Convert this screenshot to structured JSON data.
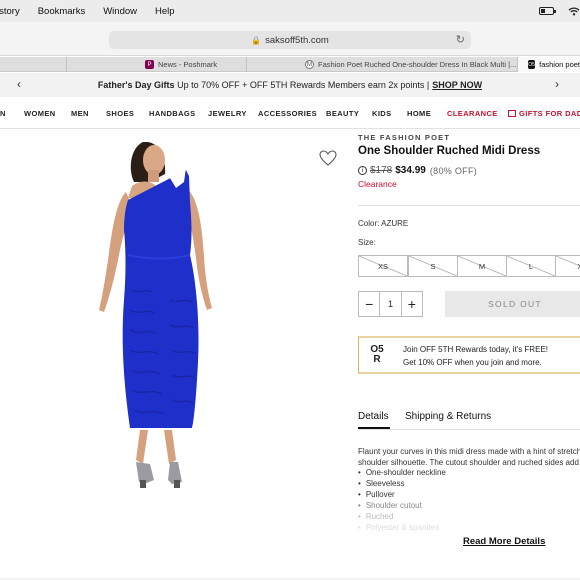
{
  "menubar": {
    "items": [
      "istory",
      "Bookmarks",
      "Window",
      "Help"
    ]
  },
  "browser": {
    "url": "saksoff5th.com",
    "tabs": [
      {
        "title": "News - Poshmark",
        "favicon": "P"
      },
      {
        "title": "Fashion Poet Ruched One-shoulder Dress In Black Multi |...",
        "favicon": "M"
      },
      {
        "title": "fashion poet",
        "favicon": "O5"
      }
    ]
  },
  "promo": {
    "bold": "Father's Day Gifts",
    "text": "Up to 70% OFF + OFF 5TH Rewards Members earn 2x points |",
    "link": "SHOP NOW"
  },
  "nav": {
    "items": [
      "N",
      "WOMEN",
      "MEN",
      "SHOES",
      "HANDBAGS",
      "JEWELRY",
      "ACCESSORIES",
      "BEAUTY",
      "KIDS",
      "HOME",
      "CLEARANCE",
      "GIFTS FOR DAD"
    ]
  },
  "product": {
    "brand": "THE FASHION POET",
    "title": "One Shoulder Ruched Midi Dress",
    "price_was": "$178",
    "price_now": "$34.99",
    "discount": "(80% OFF)",
    "tag": "Clearance",
    "color_label": "Color: AZURE",
    "size_label": "Size:",
    "sizes": [
      "XS",
      "S",
      "M",
      "L",
      "X"
    ],
    "qty": "1",
    "sold_out": "SOLD OUT",
    "dress_color": "#1f2fc9"
  },
  "rewards": {
    "logo_top": "O5",
    "logo_bottom": "R",
    "line1": "Join OFF 5TH Rewards today, it's FREE!",
    "line2": "Get 10% OFF when you join and more."
  },
  "details": {
    "tab1": "Details",
    "tab2": "Shipping & Returns",
    "description_1": "Flaunt your curves in this midi dress made with a hint of stretch",
    "description_2": "shoulder silhouette. The cutout shoulder and ruched sides add",
    "bullets": [
      "One-shoulder neckline",
      "Sleeveless",
      "Pullover",
      "Shoulder cutout",
      "Ruched",
      "Polyester & spandex"
    ],
    "read_more": "Read More Details"
  },
  "colors": {
    "clearance_red": "#c8102e"
  }
}
